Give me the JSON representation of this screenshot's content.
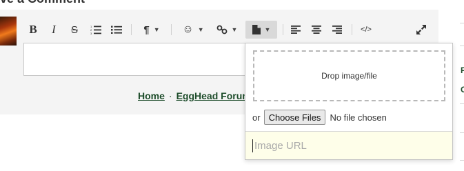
{
  "heading": "ve a Comment",
  "toolbar": {
    "bold": "B",
    "italic": "I",
    "strike": "S",
    "paragraph": "¶",
    "emoji": "☺",
    "link": "🔗",
    "code": "</>"
  },
  "footer": {
    "home": "Home",
    "separator": "·",
    "forum": "EggHead Forum"
  },
  "popup": {
    "drop_text": "Drop image/file",
    "or_label": "or",
    "choose_button": "Choose Files",
    "file_status": "No file chosen",
    "url_placeholder": "Image URL"
  },
  "right_edge": {
    "char1": "F",
    "char2": "C"
  }
}
